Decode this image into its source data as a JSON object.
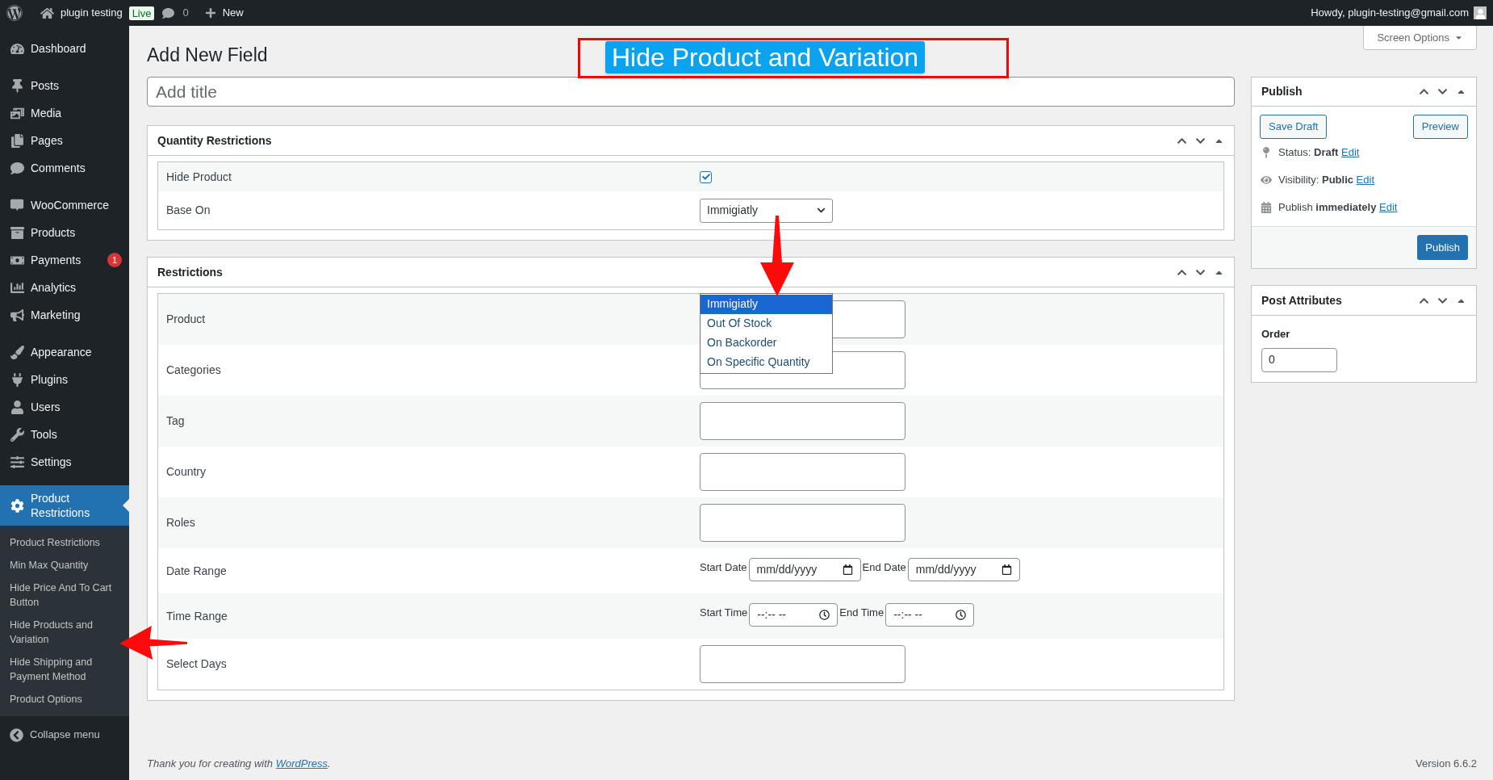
{
  "admin_bar": {
    "site_name": "plugin testing",
    "site_badge": "Live",
    "comment_count": "0",
    "new_label": "New",
    "greeting": "Howdy, plugin-testing@gmail.com"
  },
  "sidebar": {
    "groups": [
      [
        {
          "label": "Dashboard",
          "selected": false
        }
      ],
      [
        {
          "label": "Posts",
          "selected": false
        },
        {
          "label": "Media",
          "selected": false
        },
        {
          "label": "Pages",
          "selected": false
        },
        {
          "label": "Comments",
          "selected": false
        }
      ],
      [
        {
          "label": "WooCommerce",
          "selected": false
        },
        {
          "label": "Products",
          "selected": false
        },
        {
          "label": "Payments",
          "selected": false,
          "badge": "1"
        },
        {
          "label": "Analytics",
          "selected": false
        },
        {
          "label": "Marketing",
          "selected": false
        }
      ],
      [
        {
          "label": "Appearance",
          "selected": false
        },
        {
          "label": "Plugins",
          "selected": false
        },
        {
          "label": "Users",
          "selected": false
        },
        {
          "label": "Tools",
          "selected": false
        },
        {
          "label": "Settings",
          "selected": false
        }
      ],
      [
        {
          "label": "Product Restrictions",
          "selected": true,
          "children": [
            {
              "label": "Product Restrictions",
              "selected": false
            },
            {
              "label": "Min Max Quantity",
              "selected": false
            },
            {
              "label": "Hide Price And To Cart Button",
              "selected": false
            },
            {
              "label": "Hide Products and Variation",
              "selected": false
            },
            {
              "label": "Hide Shipping and Payment Method",
              "selected": false
            },
            {
              "label": "Product Options",
              "selected": false
            }
          ]
        }
      ]
    ],
    "collapse": "Collapse menu"
  },
  "page": {
    "title": "Add New Field",
    "screen_options": "Screen Options",
    "title_field": {
      "placeholder": "Add title"
    }
  },
  "annotation": {
    "text": "Hide Product and Variation"
  },
  "panels": [
    {
      "title": "Quantity Restrictions",
      "rows": [
        {
          "label": "Hide Product",
          "kind": "checkbox",
          "checked": true
        },
        {
          "label": "Base On",
          "kind": "select",
          "value": "Immigiatly",
          "expanded": true,
          "options": [
            {
              "label": "Immigiatly",
              "selected": true
            },
            {
              "label": "Out Of Stock",
              "selected": false
            },
            {
              "label": "On Backorder",
              "selected": false
            },
            {
              "label": "On Specific Quantity",
              "selected": false
            }
          ]
        }
      ]
    },
    {
      "title": "Restrictions",
      "rows": [
        {
          "label": "Product",
          "kind": "input"
        },
        {
          "label": "Categories",
          "kind": "input"
        },
        {
          "label": "Tag",
          "kind": "input"
        },
        {
          "label": "Country",
          "kind": "input"
        },
        {
          "label": "Roles",
          "kind": "input"
        },
        {
          "label": "Date Range",
          "kind": "date_range",
          "fields": [
            {
              "label": "Start Date",
              "placeholder": "mm/dd/yyyy"
            },
            {
              "label": "End Date",
              "placeholder": "mm/dd/yyyy"
            }
          ]
        },
        {
          "label": "Time Range",
          "kind": "time_range",
          "fields": [
            {
              "label": "Start Time",
              "placeholder": "--:-- --"
            },
            {
              "label": "End Time",
              "placeholder": "--:-- --"
            }
          ]
        },
        {
          "label": "Select Days",
          "kind": "input"
        }
      ]
    }
  ],
  "publish_box": {
    "title": "Publish",
    "save_draft": "Save Draft",
    "preview": "Preview",
    "meta": [
      {
        "label": "Status:",
        "value": "Draft",
        "link": "Edit"
      },
      {
        "label": "Visibility:",
        "value": "Public",
        "link": "Edit"
      },
      {
        "label": "Publish",
        "value": "immediately",
        "link": "Edit"
      }
    ],
    "publish": "Publish"
  },
  "attributes_box": {
    "title": "Post Attributes",
    "order_label": "Order",
    "order_value": "0"
  },
  "footer": {
    "text": "Thank you for creating with",
    "link": "WordPress",
    "end": ".",
    "version": "Version 6.6.2"
  }
}
